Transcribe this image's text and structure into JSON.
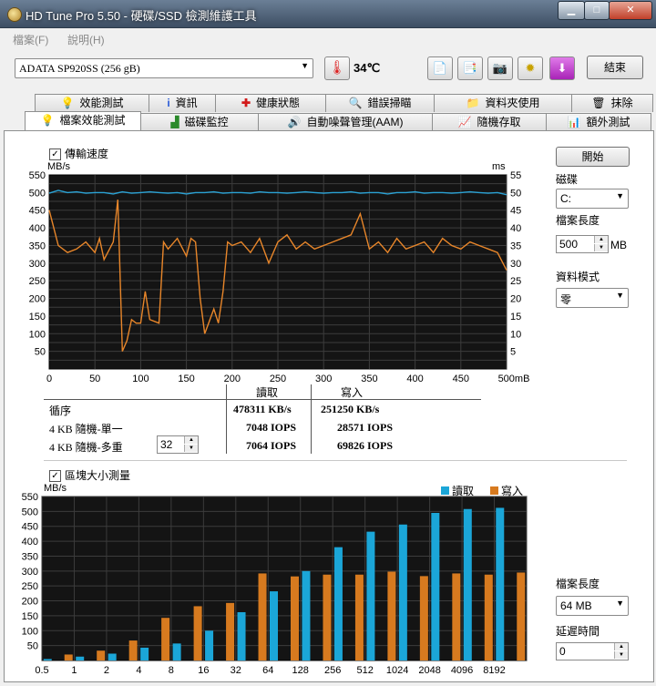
{
  "window": {
    "title": "HD Tune Pro 5.50 - 硬碟/SSD 檢測維護工具"
  },
  "menu": {
    "items": [
      "檔案(F)",
      "說明(H)"
    ]
  },
  "toolbar": {
    "drive": "ADATA   SP920SS (256 gB)",
    "temperature": "34℃",
    "exit_label": "結束"
  },
  "tabs_top": [
    "效能測試",
    "資訊",
    "健康狀態",
    "錯誤掃瞄",
    "資料夾使用",
    "抹除"
  ],
  "tabs_bottom": [
    "檔案效能測試",
    "磁碟監控",
    "自動噪聲管理(AAM)",
    "隨機存取",
    "額外測試"
  ],
  "transfer": {
    "checkbox_label": "傳輸速度",
    "left_unit": "MB/s",
    "right_unit": "ms",
    "left_ticks": [
      "550",
      "500",
      "450",
      "400",
      "350",
      "300",
      "250",
      "200",
      "150",
      "100",
      "50"
    ],
    "right_ticks": [
      "55",
      "50",
      "45",
      "40",
      "35",
      "30",
      "25",
      "20",
      "15",
      "10",
      "5"
    ],
    "x_ticks": [
      "0",
      "50",
      "100",
      "150",
      "200",
      "250",
      "300",
      "350",
      "400",
      "450",
      "500mB"
    ],
    "colors": {
      "transfer": "#2aa3d6",
      "access": "#e8862a"
    }
  },
  "results": {
    "col_read": "讀取",
    "col_write": "寫入",
    "rows": [
      {
        "label": "循序",
        "read": "478311 KB/s",
        "write": "251250 KB/s"
      },
      {
        "label": "4 KB 隨機-單一",
        "read": "7048 IOPS",
        "write": "28571 IOPS"
      },
      {
        "label": "4 KB 隨機-多重",
        "read": "7064 IOPS",
        "write": "69826 IOPS"
      }
    ],
    "queue_depth": "32"
  },
  "right_panel": {
    "start_label": "開始",
    "disk_label": "磁碟",
    "disk_value": "C:",
    "file_len_label": "檔案長度",
    "file_len_value": "500",
    "file_len_unit": "MB",
    "data_mode_label": "資料模式",
    "data_mode_value": "零"
  },
  "block": {
    "checkbox_label": "區塊大小測量",
    "unit": "MB/s",
    "legend_read": "讀取",
    "legend_write": "寫入",
    "file_len_label": "檔案長度",
    "file_len_value": "64 MB",
    "delay_label": "延遲時間",
    "delay_value": "0"
  },
  "chart_data": [
    {
      "type": "line",
      "x_range": [
        0,
        500
      ],
      "y_left_range": [
        0,
        550
      ],
      "y_right_range": [
        0,
        55
      ],
      "series": [
        {
          "axis": "left",
          "x": [
            0,
            10,
            20,
            30,
            40,
            50,
            60,
            70,
            80,
            90,
            100,
            110,
            120,
            130,
            140,
            150,
            160,
            170,
            180,
            190,
            200,
            210,
            220,
            230,
            240,
            250,
            260,
            270,
            280,
            290,
            300,
            310,
            320,
            330,
            340,
            350,
            360,
            370,
            380,
            390,
            400,
            410,
            420,
            430,
            440,
            450,
            460,
            470,
            480,
            490,
            500
          ],
          "values": [
            498,
            506,
            500,
            502,
            498,
            500,
            500,
            496,
            502,
            498,
            500,
            502,
            500,
            498,
            500,
            496,
            500,
            500,
            502,
            498,
            500,
            500,
            498,
            502,
            500,
            500,
            498,
            500,
            502,
            500,
            498,
            500,
            500,
            502,
            498,
            500,
            500,
            496,
            500,
            500,
            502,
            498,
            500,
            500,
            498,
            500,
            502,
            500,
            498,
            500,
            494
          ]
        },
        {
          "axis": "right",
          "x": [
            0,
            5,
            10,
            20,
            30,
            40,
            50,
            55,
            60,
            70,
            75,
            80,
            85,
            90,
            95,
            100,
            105,
            110,
            120,
            125,
            130,
            140,
            150,
            155,
            160,
            165,
            170,
            180,
            185,
            190,
            195,
            200,
            210,
            220,
            230,
            240,
            250,
            260,
            270,
            280,
            290,
            300,
            310,
            320,
            330,
            340,
            350,
            360,
            370,
            380,
            390,
            400,
            410,
            420,
            430,
            440,
            450,
            460,
            470,
            480,
            490,
            500
          ],
          "values": [
            45,
            40,
            35,
            33,
            34,
            36,
            33,
            37,
            31,
            36,
            48,
            5,
            8,
            14,
            13,
            13,
            22,
            14,
            13,
            36,
            34,
            37,
            32,
            37,
            36,
            20,
            10,
            17,
            13,
            22,
            36,
            35,
            36,
            33,
            37,
            30,
            36,
            38,
            34,
            36,
            34,
            35,
            36,
            37,
            38,
            44,
            34,
            36,
            33,
            37,
            34,
            35,
            36,
            33,
            37,
            35,
            34,
            36,
            35,
            34,
            33,
            28
          ]
        }
      ]
    },
    {
      "type": "bar",
      "categories": [
        "0.5",
        "1",
        "2",
        "4",
        "8",
        "16",
        "32",
        "64",
        "128",
        "256",
        "512",
        "1024",
        "2048",
        "4096",
        "8192"
      ],
      "ylim": [
        0,
        550
      ],
      "series": [
        {
          "name": "讀取",
          "values": [
            5,
            13,
            23,
            43,
            57,
            100,
            162,
            232,
            300,
            380,
            432,
            456,
            495,
            508,
            512
          ]
        },
        {
          "name": "寫入",
          "values": [
            20,
            33,
            67,
            143,
            182,
            193,
            292,
            282,
            288,
            288,
            298,
            283,
            292,
            288,
            295
          ]
        }
      ]
    }
  ]
}
